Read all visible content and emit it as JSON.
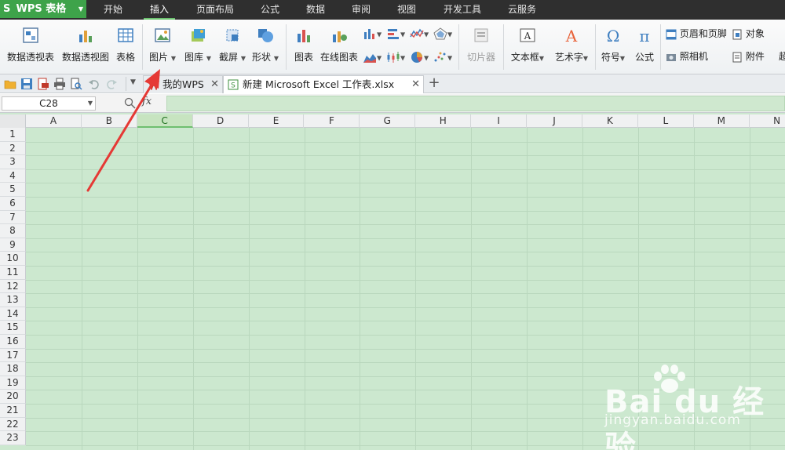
{
  "app": {
    "name": "WPS 表格",
    "logo_letter": "S"
  },
  "menu_tabs": [
    "开始",
    "插入",
    "页面布局",
    "公式",
    "数据",
    "审阅",
    "视图",
    "开发工具",
    "云服务"
  ],
  "active_menu_tab": "插入",
  "ribbon": {
    "pivot_table": "数据透视表",
    "pivot_chart": "数据透视图",
    "table": "表格",
    "picture": "图片",
    "gallery": "图库",
    "screenshot": "截屏",
    "shapes": "形状",
    "chart": "图表",
    "online_chart": "在线图表",
    "slicer": "切片器",
    "textbox": "文本框",
    "wordart": "艺术字",
    "symbol": "符号",
    "equation": "公式",
    "header_footer": "页眉和页脚",
    "object": "对象",
    "camera": "照相机",
    "attachment": "附件",
    "hyperlink_partial": "超"
  },
  "doc_tabs": [
    {
      "label": "我的WPS"
    },
    {
      "label": "新建 Microsoft Excel 工作表.xlsx"
    }
  ],
  "formula_bar": {
    "cell_ref": "C28",
    "fx": "fx",
    "value": ""
  },
  "columns": [
    "A",
    "B",
    "C",
    "D",
    "E",
    "F",
    "G",
    "H",
    "I",
    "J",
    "K",
    "L",
    "M",
    "N"
  ],
  "selected_column": "C",
  "rows": [
    "1",
    "2",
    "3",
    "4",
    "5",
    "6",
    "7",
    "8",
    "9",
    "10",
    "11",
    "12",
    "13",
    "14",
    "15",
    "16",
    "17",
    "18",
    "19",
    "20",
    "21",
    "22",
    "23"
  ],
  "watermark": {
    "brand": "Bai du 经验",
    "url": "jingyan.baidu.com"
  },
  "colors": {
    "grid_bg": "#cce8cf",
    "accent": "#3ea34a",
    "arrow": "#e53935"
  }
}
